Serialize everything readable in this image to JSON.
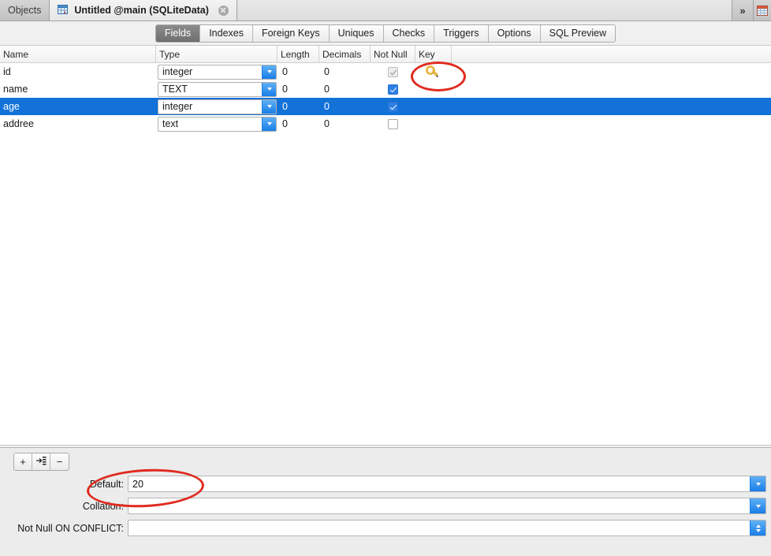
{
  "window": {
    "tabs": [
      {
        "label": "Objects",
        "icon": "",
        "active": false,
        "closable": false
      },
      {
        "label": "Untitled @main (SQLiteData)",
        "icon": "table-design-icon",
        "active": true,
        "closable": true
      }
    ],
    "overflow_label": "»",
    "right_icon": "table-icon"
  },
  "designer_tabs": {
    "items": [
      {
        "label": "Fields",
        "active": true
      },
      {
        "label": "Indexes",
        "active": false
      },
      {
        "label": "Foreign Keys",
        "active": false
      },
      {
        "label": "Uniques",
        "active": false
      },
      {
        "label": "Checks",
        "active": false
      },
      {
        "label": "Triggers",
        "active": false
      },
      {
        "label": "Options",
        "active": false
      },
      {
        "label": "SQL Preview",
        "active": false
      }
    ]
  },
  "grid": {
    "columns": [
      "Name",
      "Type",
      "Length",
      "Decimals",
      "Not Null",
      "Key",
      ""
    ],
    "rows": [
      {
        "name": "id",
        "type": "integer",
        "length": "0",
        "decimals": "0",
        "not_null": "checked-disabled",
        "key": "primary-key",
        "selected": false
      },
      {
        "name": "name",
        "type": "TEXT",
        "length": "0",
        "decimals": "0",
        "not_null": "checked",
        "key": "",
        "selected": false
      },
      {
        "name": "age",
        "type": "integer",
        "length": "0",
        "decimals": "0",
        "not_null": "checked",
        "key": "",
        "selected": true
      },
      {
        "name": "addree",
        "type": "text",
        "length": "0",
        "decimals": "0",
        "not_null": "unchecked",
        "key": "",
        "selected": false
      }
    ]
  },
  "bottom_panel": {
    "toolbar": [
      {
        "name": "add-field-button",
        "glyph": "+"
      },
      {
        "name": "insert-field-button",
        "glyph": "→"
      },
      {
        "name": "remove-field-button",
        "glyph": "−"
      }
    ],
    "fields": [
      {
        "label": "Default:",
        "value": "20",
        "placeholder": ""
      },
      {
        "label": "Collation:",
        "value": "",
        "placeholder": ""
      },
      {
        "label": "Not Null ON CONFLICT:",
        "value": "",
        "placeholder": ""
      }
    ]
  },
  "annotations": [
    {
      "name": "key-highlight",
      "shape": "ellipse",
      "color": "#e02b20",
      "target": "primary-key-icon"
    },
    {
      "name": "default-highlight",
      "shape": "ellipse",
      "color": "#e02b20",
      "target": "default-field"
    }
  ],
  "colors": {
    "selection_blue": "#1272d8",
    "accent_blue": "#1a7ee8",
    "annotation_red": "#e02b20",
    "panel_gray": "#ececec"
  }
}
